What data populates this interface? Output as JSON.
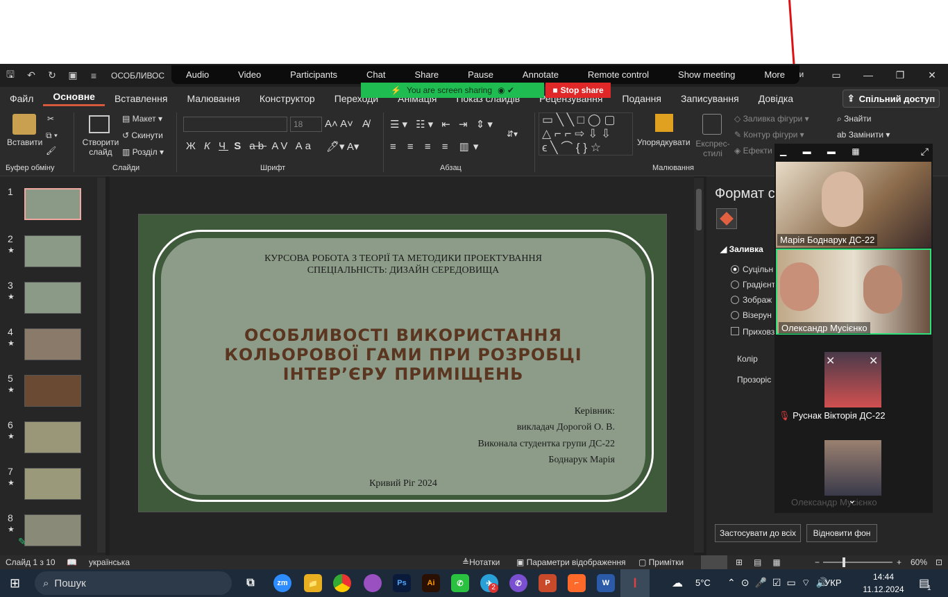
{
  "zoom_toolbar": {
    "items": [
      "Audio",
      "Video",
      "Participants",
      "Chat",
      "Share",
      "Pause",
      "Annotate",
      "Remote control",
      "Show meeting",
      "More"
    ],
    "sharing_text": "You are screen sharing",
    "stop_share": "Stop share"
  },
  "titlebar": {
    "title": "ОСОБЛИВОС",
    "partial_right": "ти"
  },
  "menu": {
    "items": [
      "Файл",
      "Основне",
      "Вставлення",
      "Малювання",
      "Конструктор",
      "Переходи",
      "Анімація",
      "Показ слайдів",
      "Рецензування",
      "Подання",
      "Записування",
      "Довідка"
    ],
    "active": "Основне",
    "share": "Спільний доступ"
  },
  "ribbon": {
    "paste": "Вставити",
    "clipboard": "Буфер обміну",
    "create_slide": "Створити слайд",
    "layout": "Макет",
    "reset": "Скинути",
    "section": "Розділ",
    "slides": "Слайди",
    "font_size": "18",
    "font_group": "Шрифт",
    "paragraph": "Абзац",
    "arrange": "Упорядкувати",
    "quick_styles": "Експрес-стилі",
    "shape_fill": "Заливка фігури",
    "shape_outline": "Контур фігури",
    "effects": "Ефекти",
    "drawing": "Малювання",
    "find": "Знайти",
    "replace": "Замінити"
  },
  "thumbnails": [
    {
      "num": "1",
      "star": "",
      "bg": "#8a9a86"
    },
    {
      "num": "2",
      "star": "★",
      "bg": "#8a9a86"
    },
    {
      "num": "3",
      "star": "★",
      "bg": "#8a9a86"
    },
    {
      "num": "4",
      "star": "★",
      "bg": "#8a7a6a"
    },
    {
      "num": "5",
      "star": "★",
      "bg": "#6b4a34"
    },
    {
      "num": "6",
      "star": "★",
      "bg": "#9a9678"
    },
    {
      "num": "7",
      "star": "★",
      "bg": "#9a9a7a"
    },
    {
      "num": "8",
      "star": "★",
      "bg": "#8a8a78"
    }
  ],
  "slide": {
    "head1": "КУРСОВА РОБОТА З ТЕОРІЇ ТА МЕТОДИКИ ПРОЕКТУВАННЯ",
    "head2": "СПЕЦІАЛЬНІСТЬ: ДИЗАЙН СЕРЕДОВИЩА",
    "title1": "ОСОБЛИВОСТІ ВИКОРИСТАННЯ",
    "title2": "КОЛЬОРОВОЇ ГАМИ ПРИ РОЗРОБЦІ",
    "title3": "ІНТЕР’ЄРУ ПРИМІЩЕНЬ",
    "supervisor_label": "Керівник:",
    "supervisor": "викладач Дорогой О. В.",
    "student_label": "Виконала студентка групи ДС-22",
    "student": "Боднарук Марія",
    "city": "Кривий Ріг 2024"
  },
  "format_pane": {
    "title": "Формат с",
    "fill": "Заливка",
    "options": [
      "Суцільн",
      "Градієнт",
      "Зображ",
      "Візерун"
    ],
    "hide": "Приховз",
    "color": "Колір",
    "transparency": "Прозоріс",
    "apply_all": "Застосувати до всіх",
    "reset_bg": "Відновити фон"
  },
  "video": {
    "p1": "Марія Боднарук ДС-22",
    "p2": "Олександр Мусієнко",
    "p3": "Руснак Вікторія ДС-22",
    "p4": "Олександр Мусієнко"
  },
  "status": {
    "slide_count": "Слайд 1 з 10",
    "language": "українська",
    "notes": "Нотатки",
    "display": "Параметри відображення",
    "comments": "Примітки",
    "zoom": "60%"
  },
  "taskbar": {
    "search": "Пошук",
    "temp": "5°C",
    "lang": "УКР",
    "time": "14:44",
    "date": "11.12.2024",
    "notif": "1",
    "badge": "2"
  }
}
